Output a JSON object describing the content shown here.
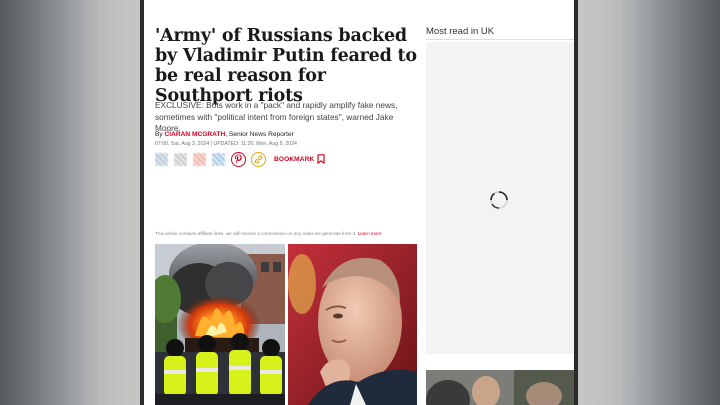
{
  "article": {
    "headline": "'Army' of Russians backed by Vladimir Putin feared to be real reason for Southport riots",
    "standfirst": "EXCLUSIVE: Bots work in a \"pack\" and rapidly amplify fake news, sometimes with \"political intent from foreign states\", warned Jake Moore.",
    "byline_prefix": "By",
    "author": "CIARAN MCGRATH",
    "author_role": ", Senior News Reporter",
    "dates": "07:00, Sat, Aug 3, 2024 | UPDATED: 11:20, Mon, Aug 5, 2024"
  },
  "share": {
    "bookmark_label": "BOOKMARK",
    "icons": [
      "facebook-icon",
      "x-icon",
      "reddit-icon",
      "email-icon",
      "pinterest-icon",
      "link-icon",
      "bookmark-icon"
    ]
  },
  "affiliate": {
    "text": "This article contains affiliate links, we will receive a commission on any sales we generate from it. ",
    "link": "Learn more"
  },
  "sidebar": {
    "title": "Most read in UK"
  },
  "colors": {
    "accent": "#d8001f",
    "link_icon": "#e7a700",
    "headline": "#1a1a1a"
  }
}
